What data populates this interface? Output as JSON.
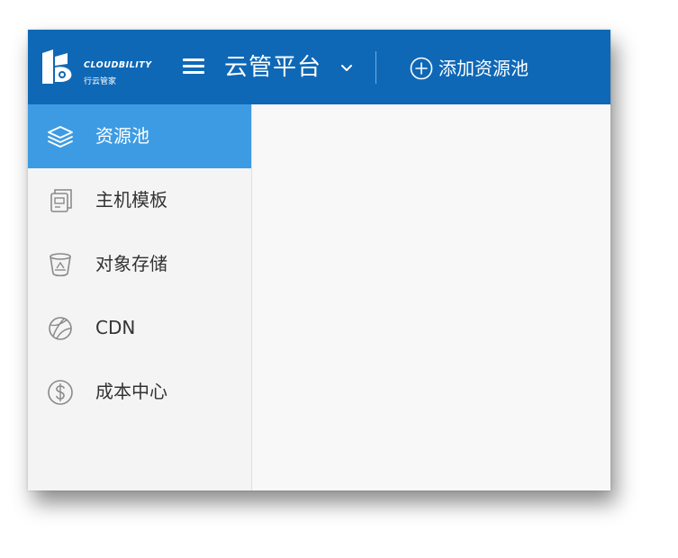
{
  "header": {
    "brand_name": "CLOUDBILITY",
    "brand_sub": "行云管家",
    "platform_title": "云管平台",
    "add_pool_label": "添加资源池"
  },
  "sidebar": {
    "items": [
      {
        "label": "资源池",
        "icon": "layers-icon",
        "active": true
      },
      {
        "label": "主机模板",
        "icon": "host-template-icon",
        "active": false
      },
      {
        "label": "对象存储",
        "icon": "bucket-icon",
        "active": false
      },
      {
        "label": "CDN",
        "icon": "globe-icon",
        "active": false
      },
      {
        "label": "成本中心",
        "icon": "dollar-icon",
        "active": false
      }
    ]
  },
  "colors": {
    "header_bg": "#0f68b6",
    "active_item_bg": "#3d9be3",
    "sidebar_bg": "#f4f4f4",
    "content_bg": "#f8f8f8"
  }
}
